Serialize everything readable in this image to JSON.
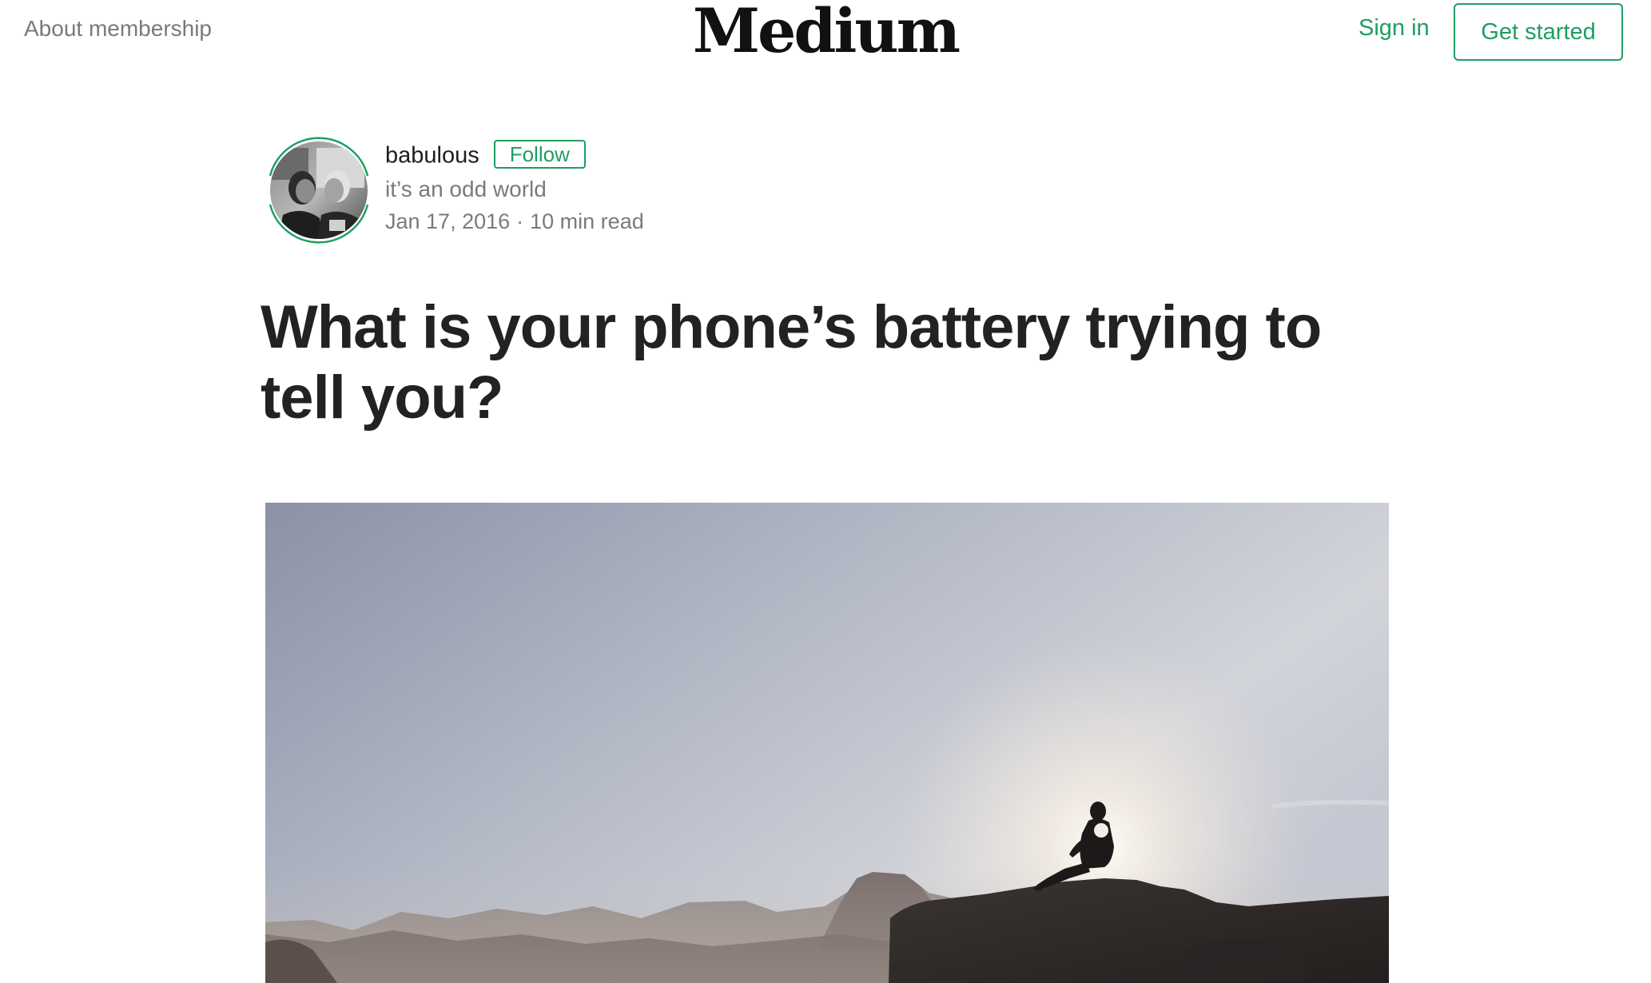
{
  "header": {
    "about_label": "About membership",
    "logo_text": "Medium",
    "sign_in_label": "Sign in",
    "get_started_label": "Get started"
  },
  "author": {
    "name": "babulous",
    "follow_label": "Follow",
    "bio": "it’s an odd world",
    "date": "Jan 17, 2016",
    "separator": "·",
    "read_time": "10 min read"
  },
  "article": {
    "title": "What is your phone’s battery trying to tell you?"
  },
  "colors": {
    "accent": "#1e9e62",
    "text_primary": "#222222",
    "text_muted": "#7a7a7a"
  },
  "icons": {
    "avatar": "author-avatar-photo",
    "hero": "hero-image-mountain-silhouette"
  }
}
